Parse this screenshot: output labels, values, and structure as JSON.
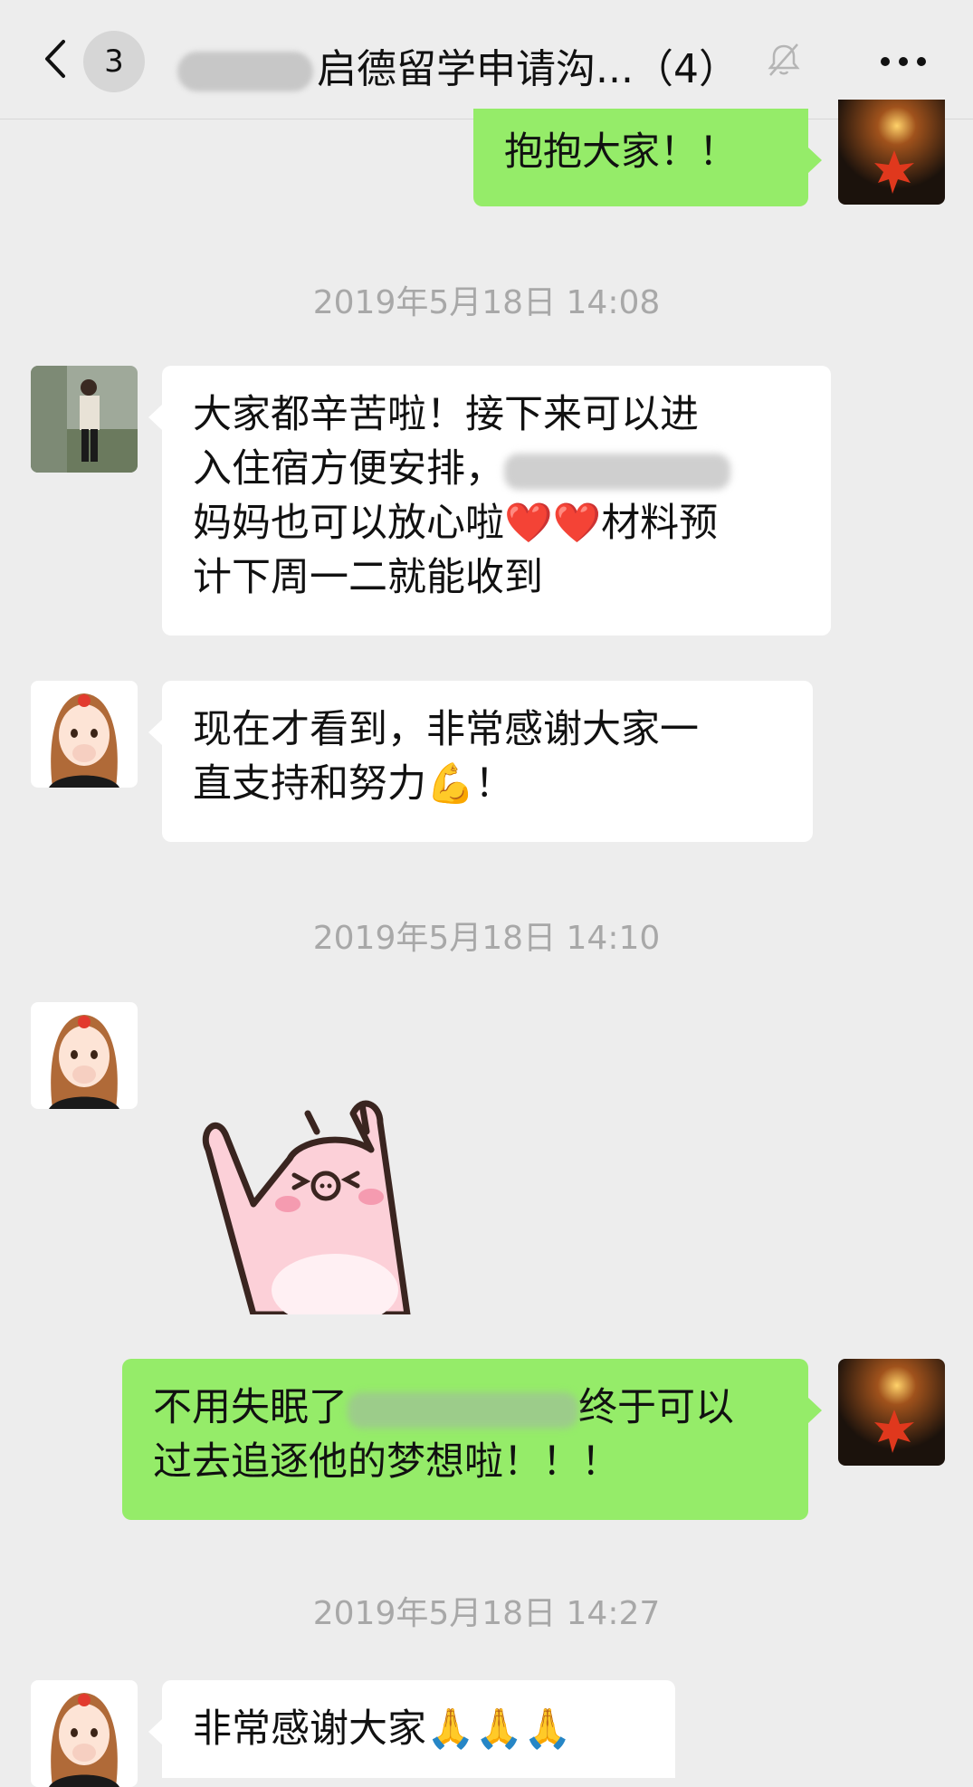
{
  "header": {
    "badge_count": "3",
    "title": "启德留学申请沟...（4）",
    "back_icon": "chevron-left-icon",
    "mute_icon": "bell-off-icon",
    "more_icon": "ellipsis-icon"
  },
  "messages": {
    "m1_text": "抱抱大家！！",
    "ts1": "2019年5月18日 14:08",
    "m2_line1": "大家都辛苦啦！接下来可以进",
    "m2_line2_a": "入住宿方便安排，",
    "m2_line3_a": "妈妈也可以放心啦",
    "m2_emoji": "❤️❤️",
    "m2_line3_b": "材料预",
    "m2_line4": "计下周一二就能收到",
    "m3_line1": "现在才看到，非常感谢大家一",
    "m3_line2": "直支持和努力",
    "m3_emoji": "💪",
    "m3_line2_end": "！",
    "ts2": "2019年5月18日 14:10",
    "m5_line1_a": "不用失眠了",
    "m5_line1_b": "终于可以",
    "m5_line2": "过去追逐他的梦想啦！！！",
    "ts3": "2019年5月18日 14:27",
    "m6_text": "非常感谢大家",
    "m6_emoji": "🙏🙏🙏"
  },
  "colors": {
    "background": "#ededed",
    "bubble_self": "#95ec69",
    "bubble_other": "#ffffff",
    "timestamp": "#a8a8a8"
  }
}
